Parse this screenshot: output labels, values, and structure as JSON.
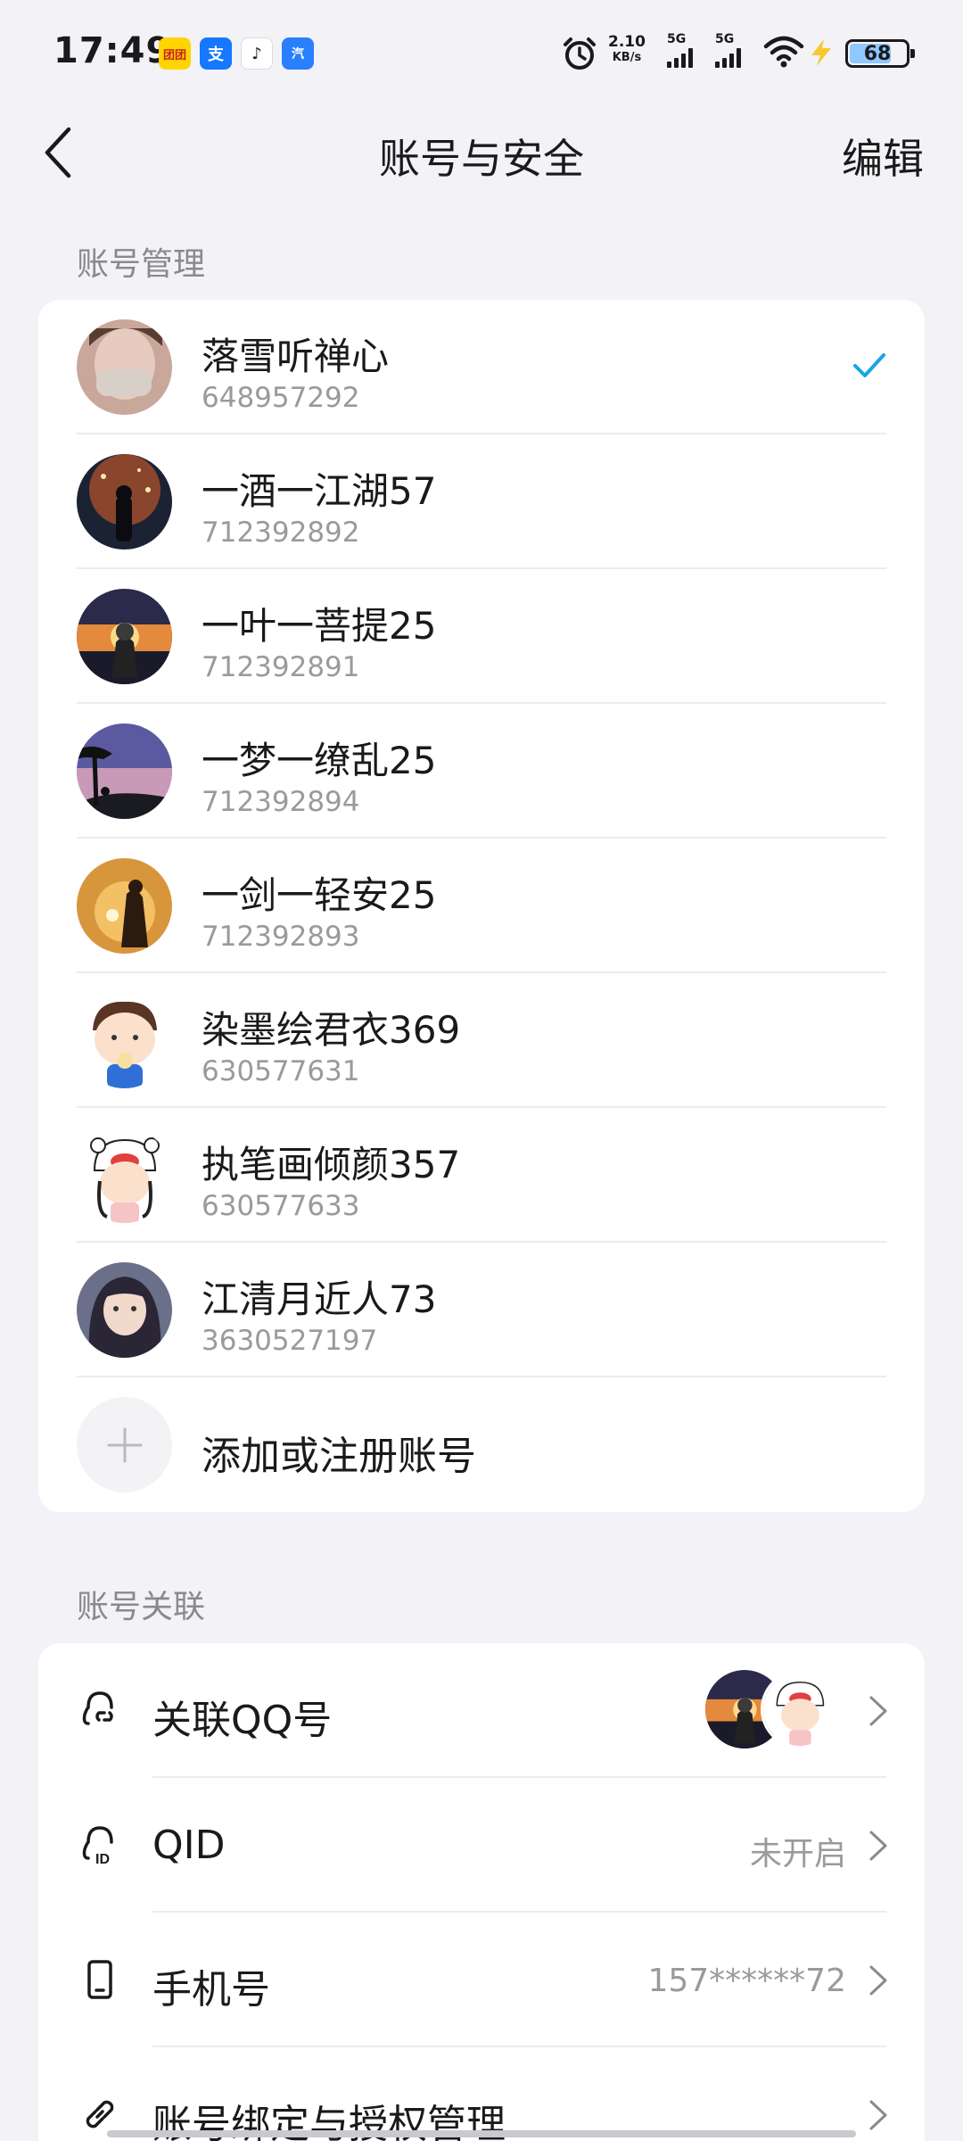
{
  "status": {
    "time": "17:49",
    "net_speed_value": "2.10",
    "net_speed_unit": "KB/s",
    "sim1": "5G",
    "sim2": "5G",
    "battery": "68",
    "app_icons": [
      {
        "name": "meituan-icon",
        "glyph": "团团",
        "color": "#ffd400"
      },
      {
        "name": "alipay-icon",
        "glyph": "支",
        "color": "#1677ff"
      },
      {
        "name": "app-icon",
        "glyph": "♪",
        "color": "#ffffff"
      },
      {
        "name": "autohome-icon",
        "glyph": "汽",
        "color": "#2a7fff"
      }
    ]
  },
  "nav": {
    "title": "账号与安全",
    "edit_label": "编辑"
  },
  "account_management": {
    "header": "账号管理",
    "accounts": [
      {
        "name": "落雪听禅心",
        "id": "648957292",
        "selected": true
      },
      {
        "name": "一酒一江湖57",
        "id": "712392892",
        "selected": false
      },
      {
        "name": "一叶一菩提25",
        "id": "712392891",
        "selected": false
      },
      {
        "name": "一梦一缭乱25",
        "id": "712392894",
        "selected": false
      },
      {
        "name": "一剑一轻安25",
        "id": "712392893",
        "selected": false
      },
      {
        "name": "染墨绘君衣369",
        "id": "630577631",
        "selected": false
      },
      {
        "name": "执笔画倾颜357",
        "id": "630577633",
        "selected": false
      },
      {
        "name": "江清月近人73",
        "id": "3630527197",
        "selected": false
      }
    ],
    "add_label": "添加或注册账号"
  },
  "account_links": {
    "header": "账号关联",
    "rows": [
      {
        "label": "关联QQ号",
        "value": "",
        "icon": "qq-link-icon"
      },
      {
        "label": "QID",
        "value": "未开启",
        "icon": "qid-icon"
      },
      {
        "label": "手机号",
        "value": "157******72",
        "icon": "phone-icon"
      },
      {
        "label": "账号绑定与授权管理",
        "value": "",
        "icon": "link-icon"
      }
    ]
  },
  "colors": {
    "accent": "#1aa3e8",
    "background": "#f2f2f7",
    "card": "#ffffff",
    "secondary_text": "#9a9a9e"
  }
}
